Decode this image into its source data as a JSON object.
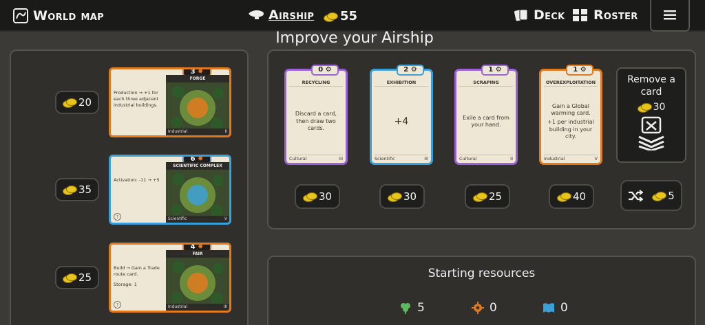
{
  "nav": {
    "world_map": "World map",
    "airship": "Airship",
    "coins": "55",
    "deck": "Deck",
    "roster": "Roster"
  },
  "title": "Improve your Airship",
  "left_cards": [
    {
      "price": "20",
      "cost": "3",
      "name": "FORGE",
      "text": "Production → +1 for each three adjacent industrial buildings.",
      "type": "Industrial",
      "tier": "II",
      "color": "#e07a1f",
      "has_help": false
    },
    {
      "price": "35",
      "cost": "6",
      "name": "SCIENTIFIC COMPLEX",
      "text": "Activation: -11 → +5",
      "type": "Scientific",
      "tier": "V",
      "color": "#3ba0d8",
      "has_help": true
    },
    {
      "price": "25",
      "cost": "4",
      "name": "FAIR",
      "text": "Build → Gain a Trade route card.",
      "text2": "Storage: 1",
      "type": "Industrial",
      "tier": "III",
      "color": "#e07a1f",
      "has_help": true
    }
  ],
  "shop_cards": [
    {
      "cost": "0",
      "name": "RECYCLING",
      "text": "Discard a card, then draw two cards.",
      "type": "Cultural",
      "tier": "III",
      "price": "30",
      "color": "#9a62d6"
    },
    {
      "cost": "2",
      "name": "EXHIBITION",
      "text": "+4",
      "type": "Scientific",
      "tier": "III",
      "price": "30",
      "color": "#3ba0d8"
    },
    {
      "cost": "1",
      "name": "SCRAPING",
      "text": "Exile a card from your hand.",
      "type": "Cultural",
      "tier": "II",
      "price": "25",
      "color": "#9a62d6"
    },
    {
      "cost": "1",
      "name": "OVEREXPLOITATION",
      "text": "Gain a Global warming card.",
      "text2": "+1 per industrial building in your city.",
      "type": "Industrial",
      "tier": "V",
      "price": "40",
      "color": "#e07a1f"
    }
  ],
  "remove": {
    "label": "Remove a card",
    "price": "30",
    "shuffle_price": "5"
  },
  "starting": {
    "label": "Starting resources",
    "green": "5",
    "orange": "0",
    "blue": "0"
  }
}
